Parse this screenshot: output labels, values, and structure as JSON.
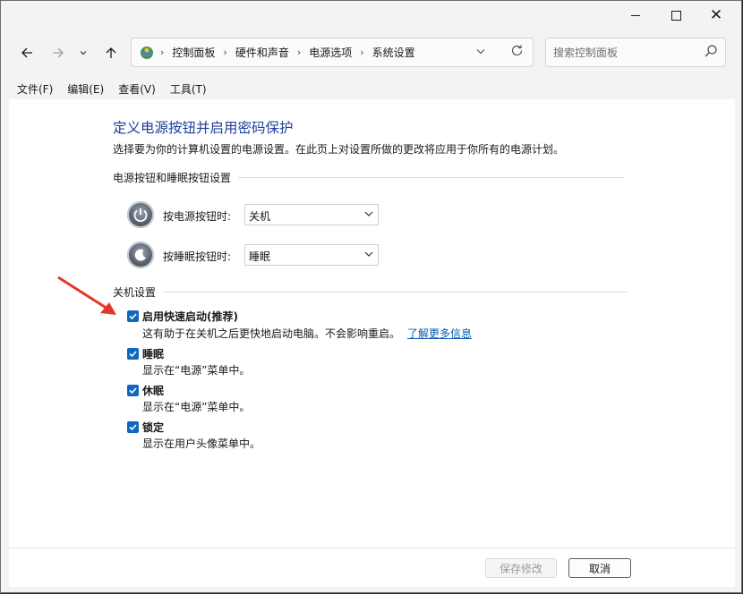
{
  "nav": {
    "breadcrumbs": [
      "控制面板",
      "硬件和声音",
      "电源选项",
      "系统设置"
    ],
    "search_placeholder": "搜索控制面板"
  },
  "menu": [
    "文件(F)",
    "编辑(E)",
    "查看(V)",
    "工具(T)"
  ],
  "page": {
    "title": "定义电源按钮并启用密码保护",
    "description": "选择要为你的计算机设置的电源设置。在此页上对设置所做的更改将应用于你所有的电源计划。"
  },
  "buttons_section": {
    "heading": "电源按钮和睡眠按钮设置",
    "power": {
      "label": "按电源按钮时:",
      "value": "关机"
    },
    "sleep": {
      "label": "按睡眠按钮时:",
      "value": "睡眠"
    }
  },
  "shutdown_section": {
    "heading": "关机设置",
    "items": [
      {
        "label": "启用快速启动(推荐)",
        "sub": "这有助于在关机之后更快地启动电脑。不会影响重启。",
        "link": "了解更多信息",
        "checked": true
      },
      {
        "label": "睡眠",
        "sub": "显示在“电源”菜单中。",
        "checked": true
      },
      {
        "label": "休眠",
        "sub": "显示在“电源”菜单中。",
        "checked": true
      },
      {
        "label": "锁定",
        "sub": "显示在用户头像菜单中。",
        "checked": true
      }
    ]
  },
  "footer": {
    "save": "保存修改",
    "cancel": "取消"
  },
  "colors": {
    "accent": "#1067c0",
    "title": "#1e3f9a",
    "annotation_arrow": "#e8352b"
  }
}
